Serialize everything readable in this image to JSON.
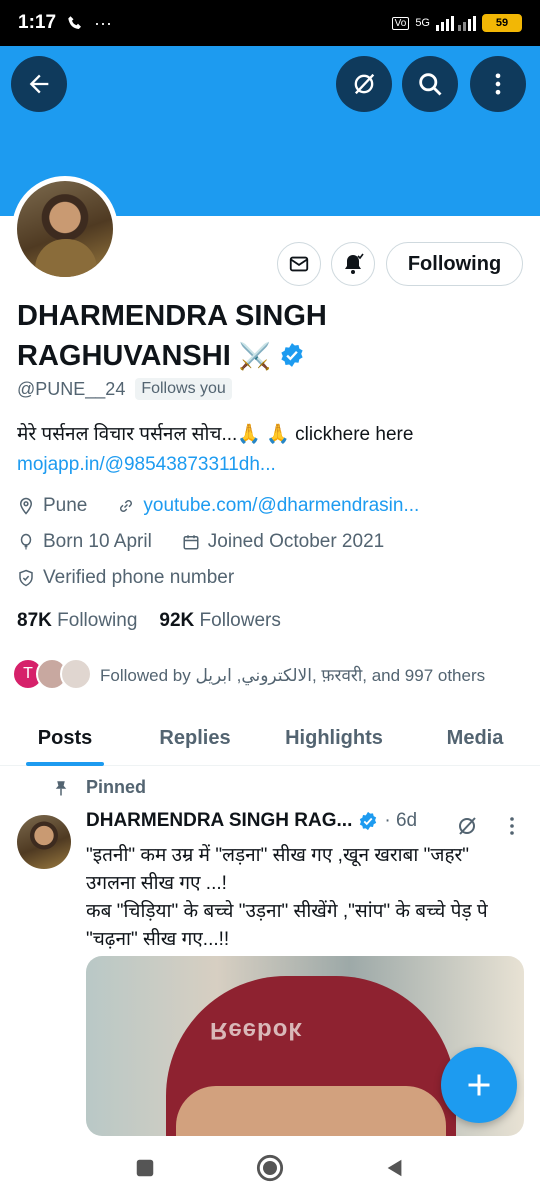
{
  "status_bar": {
    "time": "1:17",
    "network": "5G",
    "battery": "59"
  },
  "profile": {
    "name": "DHARMENDRA SINGH RAGHUVANSHI",
    "name_emoji": "⚔️",
    "handle": "@PUNE__24",
    "follows_you": "Follows you",
    "bio": "मेरे पर्सनल विचार पर्सनल सोच...🙏 🙏 clickhere here",
    "bio_link": "mojapp.in/@98543873311dh...",
    "location": "Pune",
    "website": "youtube.com/@dharmendrasin...",
    "born": "Born 10 April",
    "joined": "Joined October 2021",
    "verified_phone": "Verified phone number",
    "following_count": "87K",
    "following_label": "Following",
    "followers_count": "92K",
    "followers_label": "Followers",
    "followed_by": "Followed by الالكتروني, ابريل, फ़रवरी, and 997 others",
    "followed_avatar_letter": "T",
    "follow_button": "Following"
  },
  "tabs": [
    {
      "label": "Posts",
      "active": true
    },
    {
      "label": "Replies",
      "active": false
    },
    {
      "label": "Highlights",
      "active": false
    },
    {
      "label": "Media",
      "active": false
    }
  ],
  "post": {
    "pinned_label": "Pinned",
    "author": "DHARMENDRA SINGH RAG...",
    "time": "· 6d",
    "text_line1": "\"इतनी\" कम उम्र में \"लड़ना\" सीख गए ,खून खराबा \"जहर\" उगलना सीख गए ...!",
    "text_line2": "कब \"चिड़िया\" के बच्चे \"उड़ना\" सीखेंगे ,\"सांप\" के बच्चे पेड़ पे \"चढ़ना\" सीख गए...!!",
    "image_text": "Reebok"
  },
  "colors": {
    "accent": "#1d9bf0",
    "text": "#0f1419",
    "muted": "#536471"
  }
}
